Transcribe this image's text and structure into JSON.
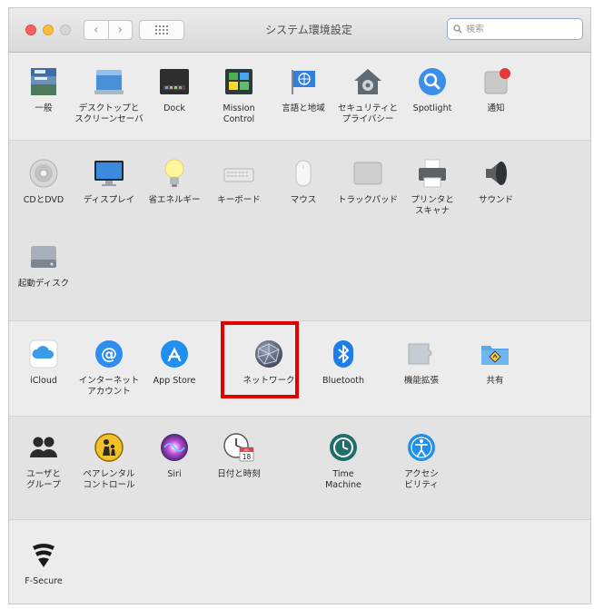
{
  "window": {
    "title": "システム環境設定"
  },
  "toolbar": {
    "back_label": "‹",
    "forward_label": "›",
    "search_placeholder": "検索"
  },
  "sections": [
    {
      "items": [
        {
          "label": "一般",
          "icon": "general-icon"
        },
        {
          "label": "デスクトップと\nスクリーンセーバ",
          "icon": "desktop-screensaver-icon"
        },
        {
          "label": "Dock",
          "icon": "dock-icon"
        },
        {
          "label": "Mission\nControl",
          "icon": "mission-control-icon"
        },
        {
          "label": "言語と地域",
          "icon": "language-region-icon"
        },
        {
          "label": "セキュリティと\nプライバシー",
          "icon": "security-privacy-icon"
        },
        {
          "label": "Spotlight",
          "icon": "spotlight-icon"
        },
        {
          "label": "通知",
          "icon": "notifications-icon"
        }
      ]
    },
    {
      "items": [
        {
          "label": "CDとDVD",
          "icon": "cd-dvd-icon"
        },
        {
          "label": "ディスプレイ",
          "icon": "display-icon"
        },
        {
          "label": "省エネルギー",
          "icon": "energy-saver-icon"
        },
        {
          "label": "キーボード",
          "icon": "keyboard-icon"
        },
        {
          "label": "マウス",
          "icon": "mouse-icon"
        },
        {
          "label": "トラックパッド",
          "icon": "trackpad-icon"
        },
        {
          "label": "プリンタと\nスキャナ",
          "icon": "printers-scanners-icon"
        },
        {
          "label": "サウンド",
          "icon": "sound-icon"
        },
        {
          "label": "起動ディスク",
          "icon": "startup-disk-icon"
        }
      ]
    },
    {
      "items": [
        {
          "label": "iCloud",
          "icon": "icloud-icon"
        },
        {
          "label": "インターネット\nアカウント",
          "icon": "internet-accounts-icon"
        },
        {
          "label": "App Store",
          "icon": "app-store-icon"
        },
        {
          "label": "ネットワーク",
          "icon": "network-icon"
        },
        {
          "label": "Bluetooth",
          "icon": "bluetooth-icon"
        },
        {
          "label": "機能拡張",
          "icon": "extensions-icon"
        },
        {
          "label": "共有",
          "icon": "sharing-icon"
        }
      ]
    },
    {
      "items": [
        {
          "label": "ユーザと\nグループ",
          "icon": "users-groups-icon"
        },
        {
          "label": "ペアレンタル\nコントロール",
          "icon": "parental-controls-icon"
        },
        {
          "label": "Siri",
          "icon": "siri-icon"
        },
        {
          "label": "日付と時刻",
          "icon": "date-time-icon"
        },
        {
          "label": "Time\nMachine",
          "icon": "time-machine-icon"
        },
        {
          "label": "アクセシ\nビリティ",
          "icon": "accessibility-icon"
        }
      ]
    },
    {
      "items": [
        {
          "label": "F-Secure",
          "icon": "f-secure-icon"
        }
      ]
    }
  ],
  "calendar": {
    "month": "JUL",
    "day": "18"
  },
  "highlight": {
    "target": "network-icon",
    "color": "#e00000"
  }
}
